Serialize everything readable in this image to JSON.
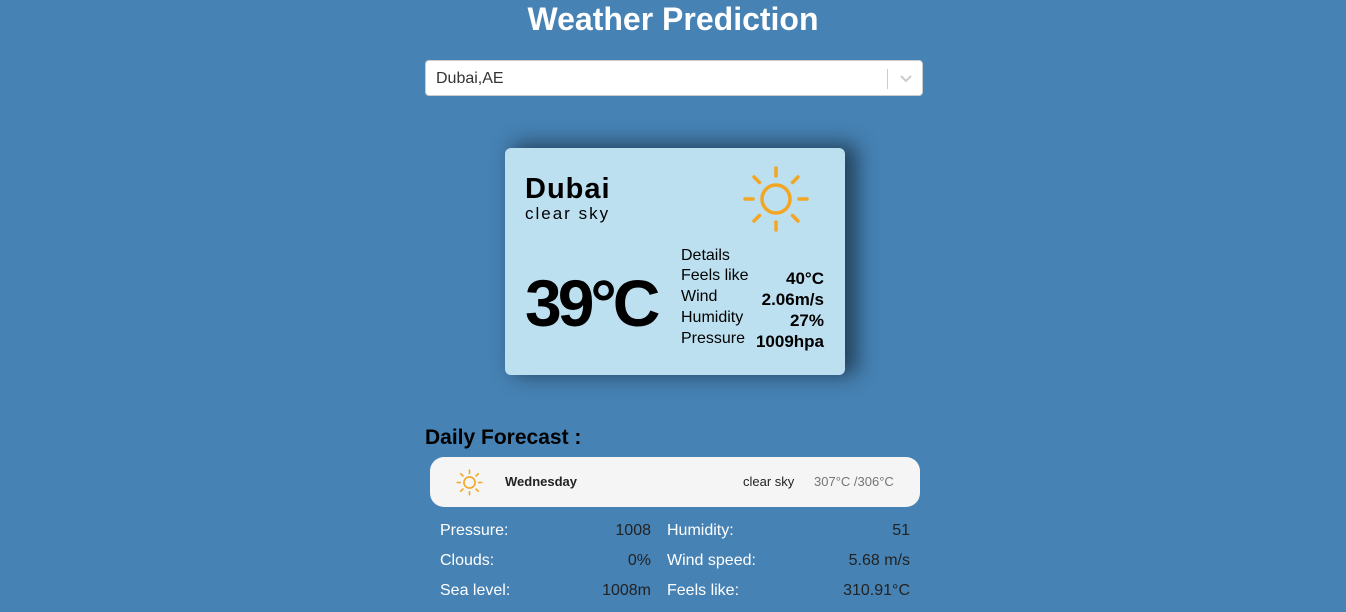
{
  "header": {
    "title": "Weather Prediction"
  },
  "search": {
    "selected_city": "Dubai,AE",
    "dropdown_icon": "chevron-down-icon"
  },
  "current": {
    "city": "Dubai",
    "description": "clear sky",
    "icon": "sun-icon",
    "icon_color": "#f2a623",
    "temperature": "39°C",
    "details_heading": "Details",
    "details": [
      {
        "label": "Feels like",
        "value": "40°C"
      },
      {
        "label": "Wind",
        "value": "2.06m/s"
      },
      {
        "label": "Humidity",
        "value": "27%"
      },
      {
        "label": "Pressure",
        "value": "1009hpa"
      }
    ]
  },
  "forecast": {
    "heading": "Daily Forecast :",
    "days": [
      {
        "icon": "sun-icon",
        "day": "Wednesday",
        "description": "clear sky",
        "min_max": "307°C /306°C",
        "details": [
          {
            "label": "Pressure:",
            "value": "1008"
          },
          {
            "label": "Humidity:",
            "value": "51"
          },
          {
            "label": "Clouds:",
            "value": "0%"
          },
          {
            "label": "Wind speed:",
            "value": "5.68 m/s"
          },
          {
            "label": "Sea level:",
            "value": "1008m"
          },
          {
            "label": "Feels like:",
            "value": "310.91°C"
          }
        ]
      }
    ]
  },
  "colors": {
    "background": "#4682b4",
    "card": "#bde0f0",
    "forecast_item": "#f5f5f5"
  }
}
